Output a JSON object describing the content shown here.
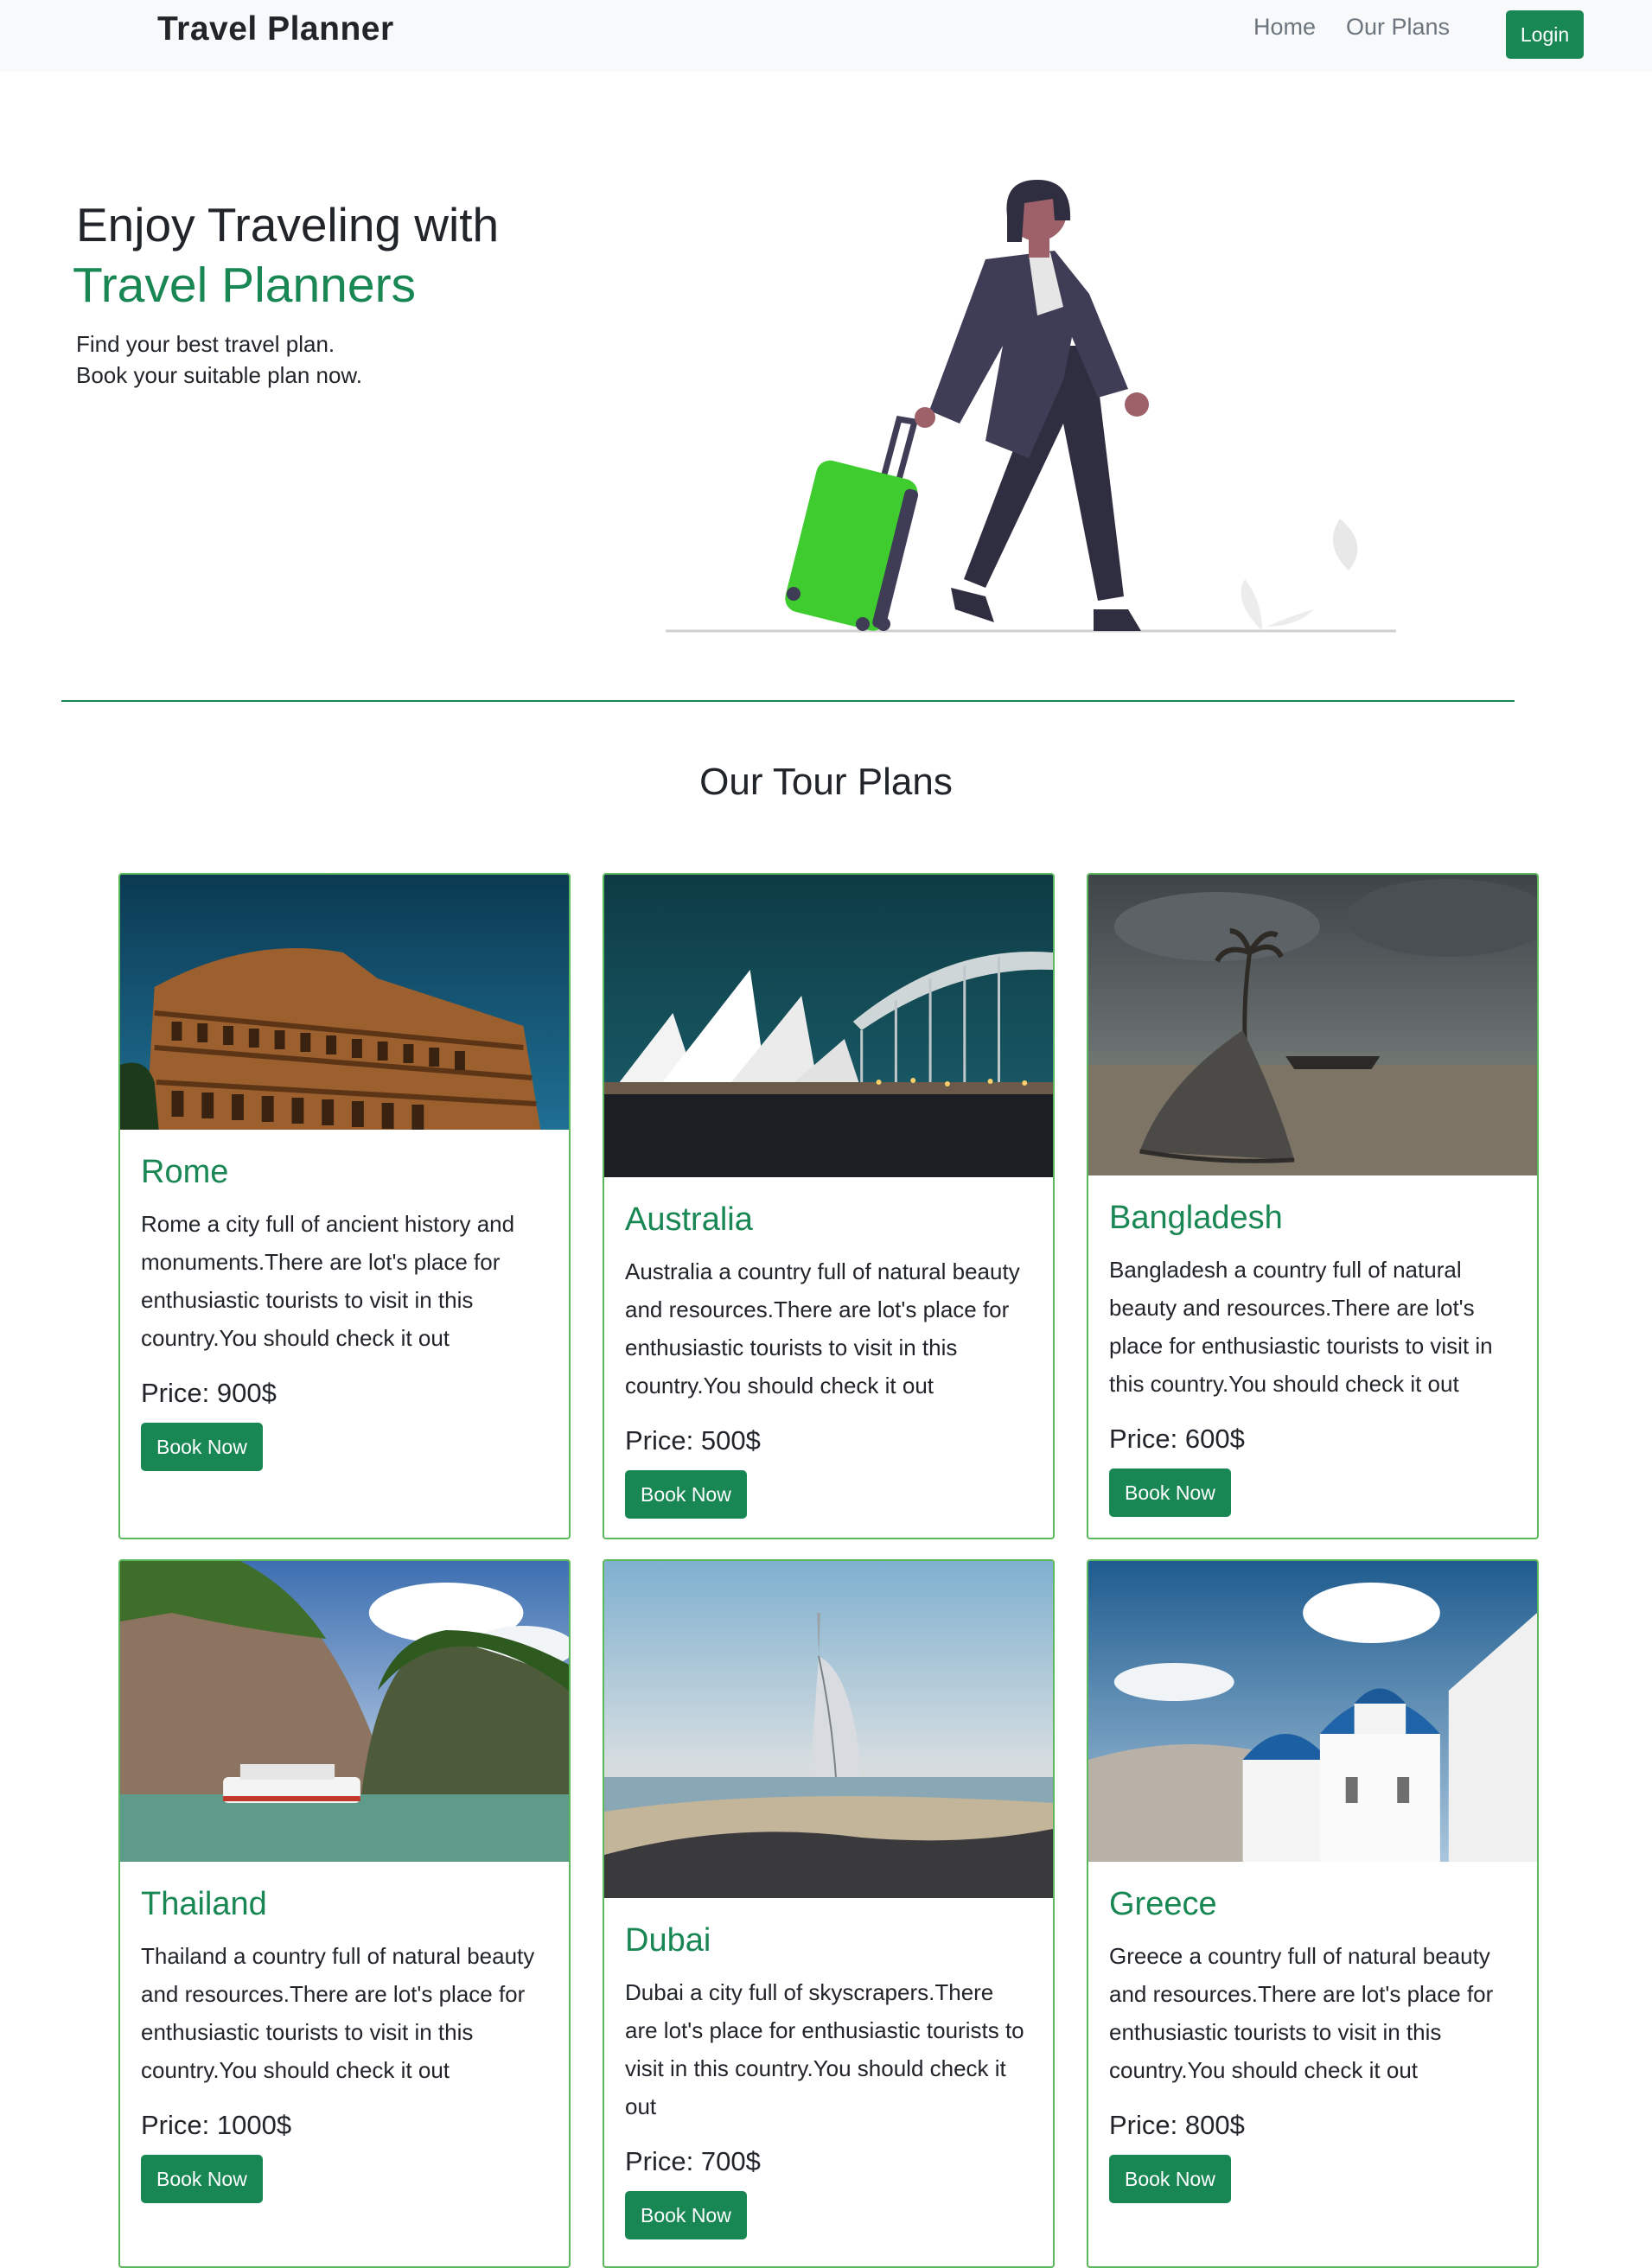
{
  "nav": {
    "brand": "Travel Planner",
    "links": [
      "Home",
      "Our Plans"
    ],
    "login_label": "Login"
  },
  "hero": {
    "line1": "Enjoy Traveling with",
    "line2": "Travel Planners",
    "sub1": "Find your best travel plan.",
    "sub2": "Book your suitable plan now."
  },
  "section_title": "Our Tour Plans",
  "plans": [
    {
      "title": "Rome",
      "text": "Rome a city full of ancient history and monuments.There are lot's place for enthusiastic tourists to visit in this country.You should check it out",
      "price": "Price: 900$",
      "button": "Book Now",
      "image": "colosseum"
    },
    {
      "title": "Australia",
      "text": "Australia a country full of natural beauty and resources.There are lot's place for enthusiastic tourists to visit in this country.You should check it out",
      "price": "Price: 500$",
      "button": "Book Now",
      "image": "sydney-opera-house"
    },
    {
      "title": "Bangladesh",
      "text": "Bangladesh a country full of natural beauty and resources.There are lot's place for enthusiastic tourists to visit in this country.You should check it out",
      "price": "Price: 600$",
      "button": "Book Now",
      "image": "beach-boat"
    },
    {
      "title": "Thailand",
      "text": "Thailand a country full of natural beauty and resources.There are lot's place for enthusiastic tourists to visit in this country.You should check it out",
      "price": "Price: 1000$",
      "button": "Book Now",
      "image": "limestone-cliffs-boat"
    },
    {
      "title": "Dubai",
      "text": "Dubai a city full of skyscrapers.There are lot's place for enthusiastic tourists to visit in this country.You should check it out",
      "price": "Price: 700$",
      "button": "Book Now",
      "image": "burj-al-arab"
    },
    {
      "title": "Greece",
      "text": "Greece a country full of natural beauty and resources.There are lot's place for enthusiastic tourists to visit in this country.You should check it out",
      "price": "Price: 800$",
      "button": "Book Now",
      "image": "santorini-domes"
    }
  ],
  "colors": {
    "accent": "#198754",
    "card_border": "#5cb85c",
    "navbar_bg": "#f8f9fa",
    "suitcase": "#3ecc2e"
  }
}
